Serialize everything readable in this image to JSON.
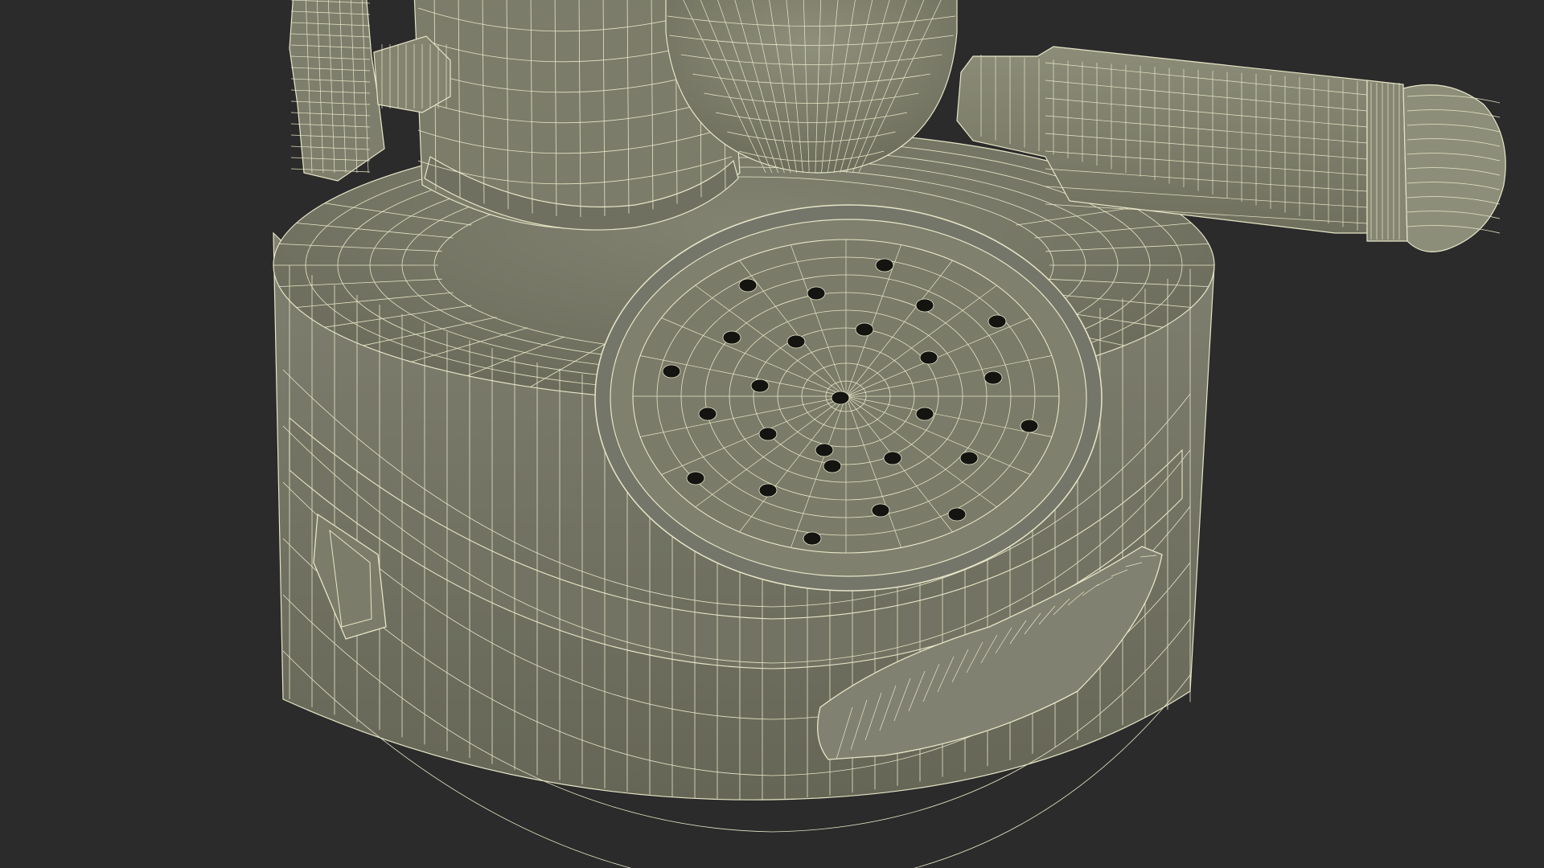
{
  "scene": {
    "subject": "wireframe-render",
    "colors": {
      "background": "#2b2b2b",
      "surface": "#7a7b68",
      "surface_dark": "#6d6e5c",
      "surface_light": "#8a8b76",
      "wire": "#e7e6c8",
      "hole": "#141411"
    }
  }
}
